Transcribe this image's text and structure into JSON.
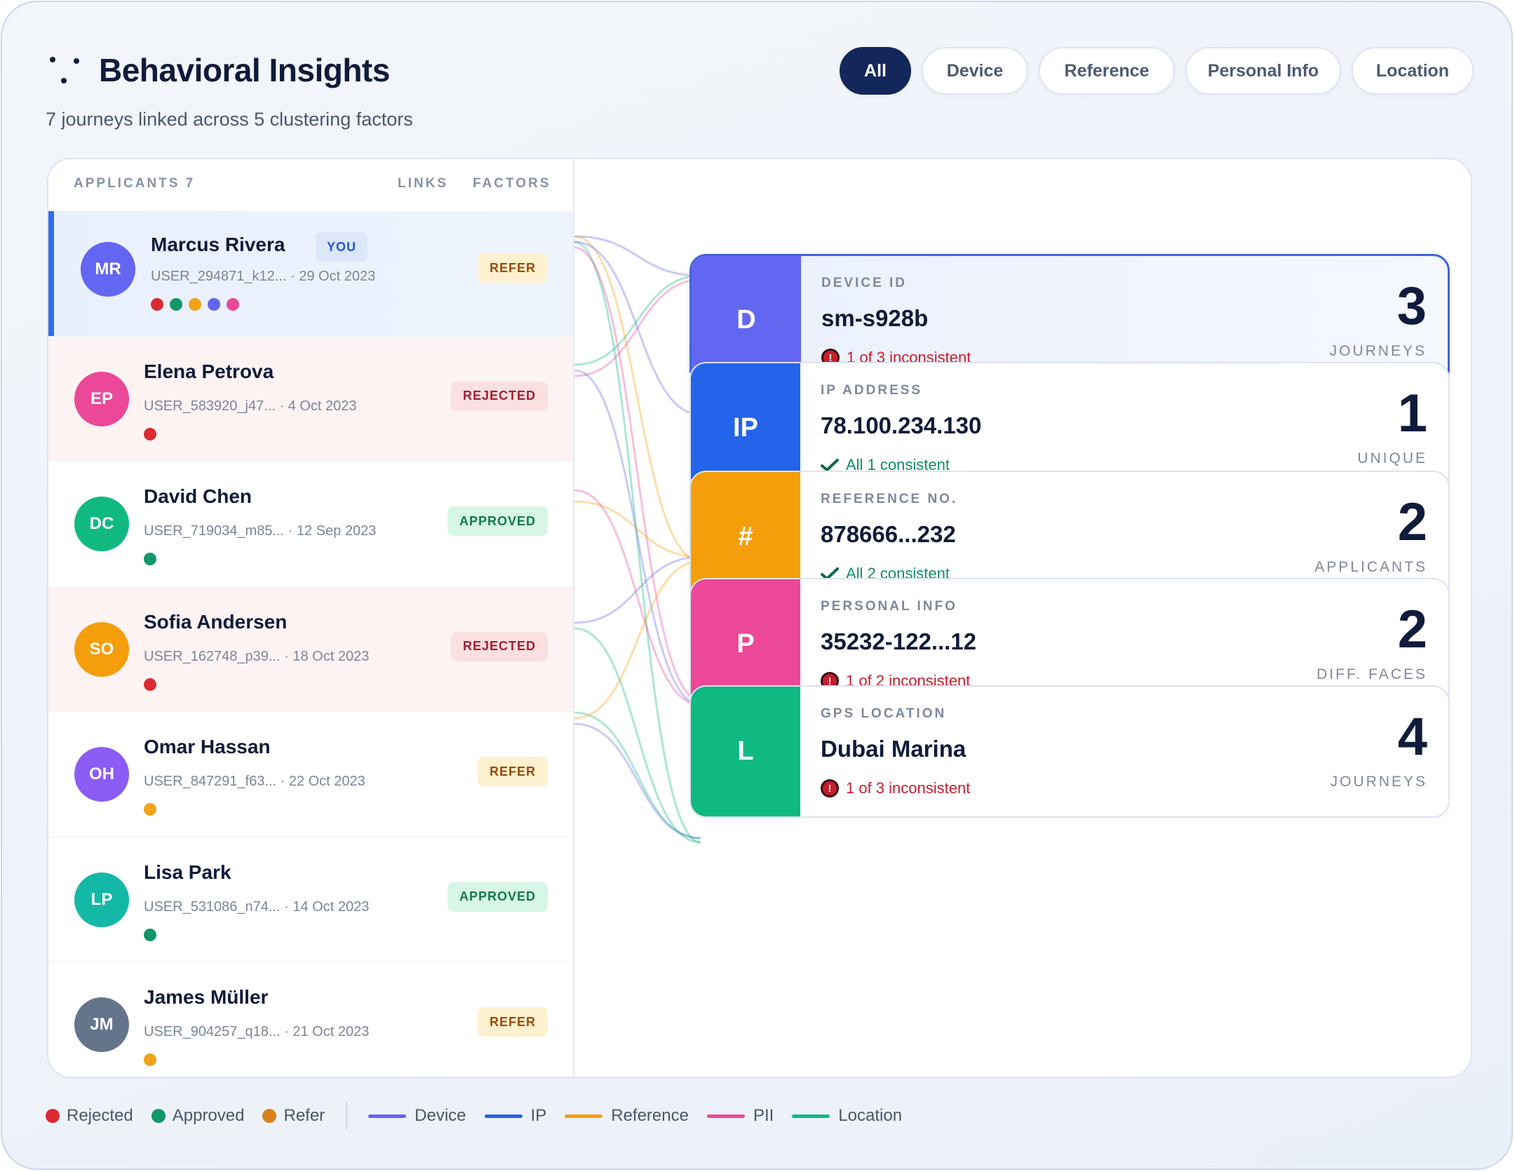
{
  "header": {
    "title": "Behavioral Insights",
    "subtitle": "7 journeys linked across 5 clustering factors"
  },
  "filters": [
    {
      "label": "All",
      "active": true
    },
    {
      "label": "Device",
      "active": false
    },
    {
      "label": "Reference",
      "active": false
    },
    {
      "label": "Personal Info",
      "active": false
    },
    {
      "label": "Location",
      "active": false
    }
  ],
  "list_header": {
    "applicants": "APPLICANTS 7",
    "links": "LINKS",
    "factors": "FACTORS"
  },
  "colors": {
    "rejected": "#dc2a34",
    "approved": "#12966a",
    "refer": "#f3a317",
    "device": "#6366f1",
    "ip": "#2563eb",
    "reference": "#f59e0b",
    "pii": "#ec4899",
    "location": "#10b981"
  },
  "applicants": [
    {
      "initials": "MR",
      "name": "Marcus Rivera",
      "you": "YOU",
      "meta": "USER_294871_k12... · 29 Oct 2023",
      "status": "REFER",
      "status_key": "refer",
      "avatar_color": "#6366f1",
      "dots": [
        "#dc2a34",
        "#12966a",
        "#f3a317",
        "#6366f1",
        "#ec4899"
      ],
      "selected": true
    },
    {
      "initials": "EP",
      "name": "Elena Petrova",
      "meta": "USER_583920_j47... · 4 Oct 2023",
      "status": "REJECTED",
      "status_key": "rejected",
      "avatar_color": "#ec4899",
      "dots": [
        "#dc2a34"
      ]
    },
    {
      "initials": "DC",
      "name": "David Chen",
      "meta": "USER_719034_m85... · 12 Sep 2023",
      "status": "APPROVED",
      "status_key": "approved",
      "avatar_color": "#10b981",
      "dots": [
        "#12966a"
      ]
    },
    {
      "initials": "SO",
      "name": "Sofia Andersen",
      "meta": "USER_162748_p39... · 18 Oct 2023",
      "status": "REJECTED",
      "status_key": "rejected",
      "avatar_color": "#f59e0b",
      "dots": [
        "#dc2a34"
      ]
    },
    {
      "initials": "OH",
      "name": "Omar Hassan",
      "meta": "USER_847291_f63... · 22 Oct 2023",
      "status": "REFER",
      "status_key": "refer",
      "avatar_color": "#8b5cf6",
      "dots": [
        "#f3a317"
      ]
    },
    {
      "initials": "LP",
      "name": "Lisa Park",
      "meta": "USER_531086_n74... · 14 Oct 2023",
      "status": "APPROVED",
      "status_key": "approved",
      "avatar_color": "#14b8a6",
      "dots": [
        "#12966a"
      ]
    },
    {
      "initials": "JM",
      "name": "James Müller",
      "meta": "USER_904257_q18... · 21 Oct 2023",
      "status": "REFER",
      "status_key": "refer",
      "avatar_color": "#64748b",
      "dots": [
        "#f3a317"
      ]
    }
  ],
  "factors": [
    {
      "tile": "D",
      "label": "DEVICE ID",
      "value": "sm-s928b",
      "status": "1 of 3 inconsistent",
      "ok": false,
      "number": "3",
      "unit": "JOURNEYS",
      "color": "#6366f1",
      "selected": true
    },
    {
      "tile": "IP",
      "label": "IP ADDRESS",
      "value": "78.100.234.130",
      "status": "All 1 consistent",
      "ok": true,
      "number": "1",
      "unit": "UNIQUE",
      "color": "#2563eb"
    },
    {
      "tile": "#",
      "label": "REFERENCE NO.",
      "value": "878666...232",
      "status": "All 2 consistent",
      "ok": true,
      "number": "2",
      "unit": "APPLICANTS",
      "color": "#f59e0b"
    },
    {
      "tile": "P",
      "label": "PERSONAL INFO",
      "value": "35232-122...12",
      "status": "1 of 2 inconsistent",
      "ok": false,
      "number": "2",
      "unit": "DIFF. FACES",
      "color": "#ec4899"
    },
    {
      "tile": "L",
      "label": "GPS LOCATION",
      "value": "Dubai Marina",
      "status": "1 of 3 inconsistent",
      "ok": false,
      "number": "4",
      "unit": "JOURNEYS",
      "color": "#10b981"
    }
  ],
  "legend": {
    "status": [
      {
        "label": "Rejected",
        "color": "#dc2a34"
      },
      {
        "label": "Approved",
        "color": "#12966a"
      },
      {
        "label": "Refer",
        "color": "#d9821b"
      }
    ],
    "factors": [
      {
        "label": "Device",
        "color": "#6366f1"
      },
      {
        "label": "IP",
        "color": "#2563eb"
      },
      {
        "label": "Reference",
        "color": "#f59e0b"
      },
      {
        "label": "PII",
        "color": "#ec4899"
      },
      {
        "label": "Location",
        "color": "#10b981"
      }
    ]
  }
}
